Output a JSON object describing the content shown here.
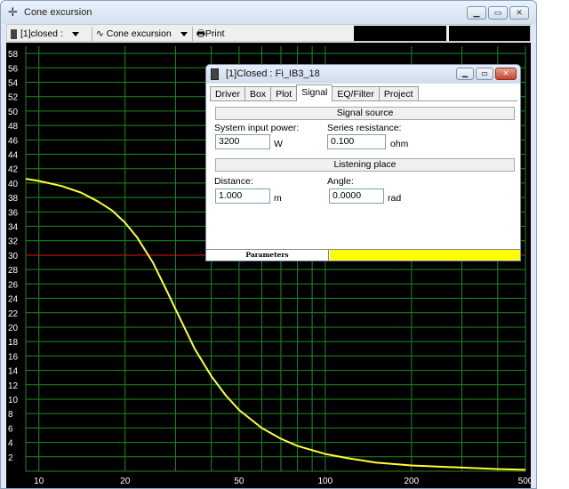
{
  "window": {
    "title": "Cone excursion",
    "title_icon": "crosshair-icon"
  },
  "toolbar": {
    "project_select": "[1]closed :",
    "view_select": "Cone excursion",
    "print_label": "Print"
  },
  "dialog": {
    "title": "[1]Closed : Fi_IB3_18",
    "tabs": [
      "Driver",
      "Box",
      "Plot",
      "Signal",
      "EQ/Filter",
      "Project"
    ],
    "active_tab": "Signal",
    "signal_source_header": "Signal source",
    "system_input_power_label": "System input power:",
    "system_input_power_value": "3200",
    "system_input_power_unit": "W",
    "series_resistance_label": "Series resistance:",
    "series_resistance_value": "0.100",
    "series_resistance_unit": "ohm",
    "listening_place_header": "Listening place",
    "distance_label": "Distance:",
    "distance_value": "1.000",
    "distance_unit": "m",
    "angle_label": "Angle:",
    "angle_value": "0.0000",
    "angle_unit": "rad",
    "status_left": "Parameters",
    "status_right_color": "#ffff00"
  },
  "chart_data": {
    "type": "line",
    "x_scale": "log",
    "xlim": [
      9,
      500
    ],
    "ylim": [
      0,
      59
    ],
    "x_ticks": [
      10,
      20,
      50,
      100,
      200,
      500
    ],
    "y_ticks": [
      2,
      4,
      6,
      8,
      10,
      12,
      14,
      16,
      18,
      20,
      22,
      24,
      26,
      28,
      30,
      32,
      34,
      36,
      38,
      40,
      42,
      44,
      46,
      48,
      50,
      52,
      54,
      56,
      58
    ],
    "grid": true,
    "background": "#000000",
    "grid_color": "#1f8a1f",
    "reference_line": {
      "y": 30,
      "color": "#d01a1a"
    },
    "series": [
      {
        "color": "#ffff33",
        "x": [
          9,
          10,
          12,
          14,
          16,
          18,
          20,
          22,
          25,
          28,
          30,
          35,
          40,
          45,
          50,
          60,
          70,
          80,
          100,
          120,
          150,
          200,
          300,
          400,
          500
        ],
        "values": [
          40.6,
          40.3,
          39.6,
          38.7,
          37.5,
          36.2,
          34.5,
          32.5,
          29.0,
          25.0,
          22.5,
          17.0,
          13.2,
          10.5,
          8.5,
          6.0,
          4.5,
          3.5,
          2.4,
          1.8,
          1.2,
          0.8,
          0.5,
          0.3,
          0.2
        ]
      }
    ]
  }
}
